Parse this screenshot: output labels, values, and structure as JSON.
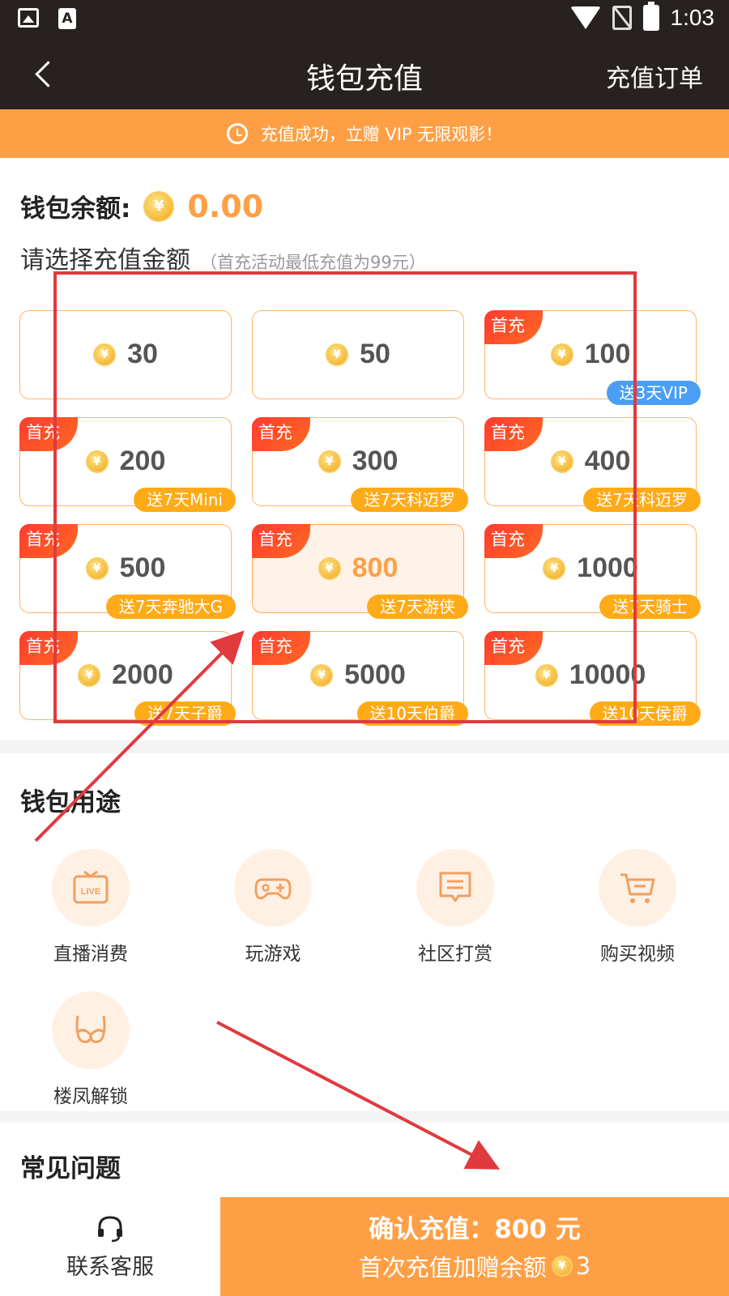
{
  "status_bar": {
    "time": "1:03"
  },
  "header": {
    "title": "钱包充值",
    "orders_link": "充值订单"
  },
  "banner": {
    "text": "充值成功，立赠 VIP 无限观影！"
  },
  "balance": {
    "label": "钱包余额:",
    "value": "0.00",
    "coin_symbol": "¥"
  },
  "select": {
    "label": "请选择充值金额",
    "hint": "（首充活动最低充值为99元）"
  },
  "ribbon_label": "首充",
  "amounts": [
    {
      "value": "30",
      "ribbon": false,
      "bonus": null,
      "selected": false
    },
    {
      "value": "50",
      "ribbon": false,
      "bonus": null,
      "selected": false
    },
    {
      "value": "100",
      "ribbon": true,
      "bonus": "送3天VIP",
      "bonus_style": "blue",
      "selected": false
    },
    {
      "value": "200",
      "ribbon": true,
      "bonus": "送7天Mini",
      "selected": false
    },
    {
      "value": "300",
      "ribbon": true,
      "bonus": "送7天科迈罗",
      "selected": false
    },
    {
      "value": "400",
      "ribbon": true,
      "bonus": "送7天科迈罗",
      "selected": false
    },
    {
      "value": "500",
      "ribbon": true,
      "bonus": "送7天奔驰大G",
      "selected": false
    },
    {
      "value": "800",
      "ribbon": true,
      "bonus": "送7天游侠",
      "selected": true
    },
    {
      "value": "1000",
      "ribbon": true,
      "bonus": "送7天骑士",
      "selected": false
    },
    {
      "value": "2000",
      "ribbon": true,
      "bonus": "送7天子爵",
      "selected": false
    },
    {
      "value": "5000",
      "ribbon": true,
      "bonus": "送10天伯爵",
      "selected": false
    },
    {
      "value": "10000",
      "ribbon": true,
      "bonus": "送10天侯爵",
      "selected": false
    }
  ],
  "usage": {
    "title": "钱包用途",
    "items": [
      {
        "label": "直播消费",
        "icon": "live-tv-icon"
      },
      {
        "label": "玩游戏",
        "icon": "gamepad-icon"
      },
      {
        "label": "社区打赏",
        "icon": "chat-message-icon"
      },
      {
        "label": "购买视频",
        "icon": "shopping-cart-icon"
      },
      {
        "label": "楼凤解锁",
        "icon": "lingerie-icon"
      }
    ]
  },
  "faq": {
    "title": "常见问题"
  },
  "bottom": {
    "service_label": "联系客服",
    "confirm_line1": "确认充值：800 元",
    "confirm_line2": "首次充值加赠余额",
    "bonus_amount": "3"
  },
  "colors": {
    "accent": "#ff9f45",
    "header_bg": "#27221f",
    "ribbon": "#ff3b2f",
    "bonus_tag": "#ffaa17",
    "vip_tag": "#4a9ff5",
    "annotation": "#e03a3e"
  }
}
